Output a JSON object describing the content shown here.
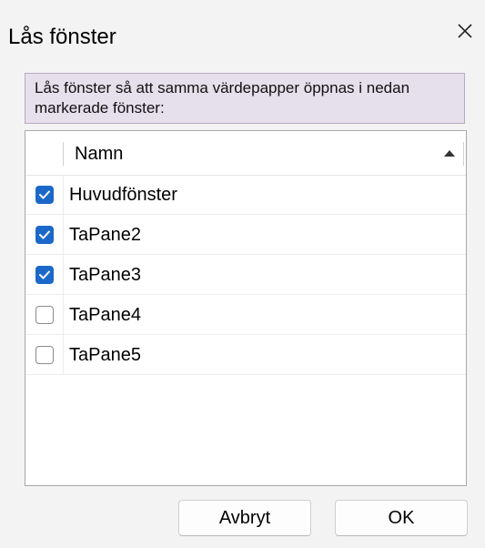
{
  "window": {
    "title": "Lås fönster"
  },
  "info": {
    "text": "Lås fönster så att samma värdepapper öppnas i nedan markerade fönster:"
  },
  "list": {
    "column_header": "Namn",
    "items": [
      {
        "label": "Huvudfönster",
        "checked": true
      },
      {
        "label": "TaPane2",
        "checked": true
      },
      {
        "label": "TaPane3",
        "checked": true
      },
      {
        "label": "TaPane4",
        "checked": false
      },
      {
        "label": "TaPane5",
        "checked": false
      }
    ]
  },
  "buttons": {
    "cancel": "Avbryt",
    "ok": "OK"
  },
  "colors": {
    "accent": "#1b68c9",
    "info_bg": "#e6dfec",
    "dialog_bg": "#f3f3f3"
  }
}
